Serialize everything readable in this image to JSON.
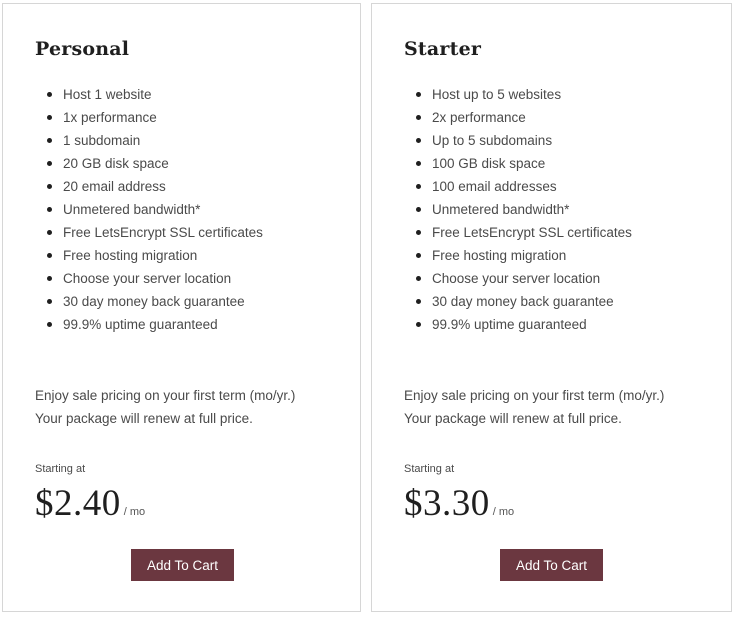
{
  "plans": [
    {
      "name": "Personal",
      "features": [
        "Host 1 website",
        "1x performance",
        "1 subdomain",
        "20 GB disk space",
        "20 email address",
        "Unmetered bandwidth*",
        "Free LetsEncrypt SSL certificates",
        "Free hosting migration",
        "Choose your server location",
        "30 day money back guarantee",
        "99.9% uptime guaranteed"
      ],
      "note_line1": "Enjoy sale pricing on your first term (mo/yr.)",
      "note_line2": "Your package will renew at full price.",
      "starting_label": "Starting at",
      "price": "$2.40",
      "per": "/ mo",
      "button_label": "Add To Cart"
    },
    {
      "name": "Starter",
      "features": [
        "Host up to 5 websites",
        "2x performance",
        "Up to 5 subdomains",
        "100 GB disk space",
        "100 email addresses",
        "Unmetered bandwidth*",
        "Free LetsEncrypt SSL certificates",
        "Free hosting migration",
        "Choose your server location",
        "30 day money back guarantee",
        "99.9% uptime guaranteed"
      ],
      "note_line1": "Enjoy sale pricing on your first term (mo/yr.)",
      "note_line2": "Your package will renew at full price.",
      "starting_label": "Starting at",
      "price": "$3.30",
      "per": "/ mo",
      "button_label": "Add To Cart"
    }
  ],
  "colors": {
    "button_bg": "#6b3740",
    "button_text": "#ffffff",
    "border": "#d6d6d6",
    "text": "#4a4a4a",
    "heading": "#1f1f1f"
  }
}
